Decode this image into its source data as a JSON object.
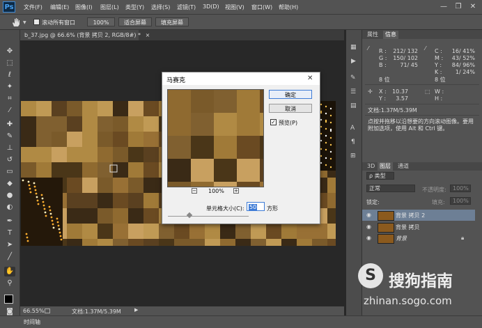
{
  "app": {
    "logo": "Ps"
  },
  "menu": [
    "文件(F)",
    "编辑(E)",
    "图像(I)",
    "图层(L)",
    "类型(Y)",
    "选择(S)",
    "滤镜(T)",
    "3D(D)",
    "视图(V)",
    "窗口(W)",
    "帮助(H)"
  ],
  "window_controls": {
    "minimize": "—",
    "restore": "❐",
    "close": "✕"
  },
  "options": {
    "scroll_all_label": "滚动所有窗口",
    "zoom_100": "100%",
    "fit_screen": "适合屏幕",
    "fill_screen": "填充屏幕"
  },
  "document": {
    "tab_label": "b_37.jpg @ 66.6% (背景 拷贝 2, RGB/8#) *",
    "tab_close": "×",
    "zoom": "66.55%",
    "doc_size": "文档:1.37M/5.39M"
  },
  "timeline_label": "时间轴",
  "dialog": {
    "title": "马赛克",
    "close": "✕",
    "ok": "确定",
    "cancel": "取消",
    "preview_label": "预览(P)",
    "preview_checked": true,
    "zoom_minus": "−",
    "zoom_plus": "+",
    "zoom_pct": "100%",
    "cell_size_label": "单元格大小(C):",
    "cell_size_value": "50",
    "cell_unit": "方形"
  },
  "info_panel": {
    "tabs": [
      "属性",
      "信息"
    ],
    "rgb_labels": [
      "R :",
      "G :",
      "B :"
    ],
    "rgb_values": [
      "212/ 132",
      "150/ 102",
      "71/ 45"
    ],
    "cmyk_labels": [
      "C :",
      "M :",
      "Y :",
      "K :"
    ],
    "cmyk_values": [
      "16/ 41%",
      "43/ 52%",
      "84/ 96%",
      "1/ 24%"
    ],
    "bit_left": "8 位",
    "bit_right": "8 位",
    "xy_labels": [
      "X :",
      "Y :"
    ],
    "xy_values": [
      "10.37",
      "3.57"
    ],
    "wh_labels": [
      "W :",
      "H :"
    ],
    "doc_size": "文档:1.37M/5.39M",
    "hint": "点按并拖移以沿想要的方向滚动图像。要用附加选项，使用 Alt 和 Ctrl 键。"
  },
  "layers_panel": {
    "tabs": [
      "3D",
      "图层",
      "通道"
    ],
    "filter_type": "ρ 类型",
    "blend_mode": "正常",
    "opacity_label": "不透明度:",
    "opacity_value": "100%",
    "lock_label": "锁定:",
    "fill_label": "填充:",
    "fill_value": "100%",
    "layers": [
      {
        "name": "背景 拷贝 2",
        "selected": true
      },
      {
        "name": "背景 拷贝",
        "selected": false
      },
      {
        "name": "背景",
        "selected": false,
        "locked": true
      }
    ]
  },
  "watermark": {
    "brand": "搜狗指南",
    "url": "zhinan.sogo.com"
  },
  "colors": {
    "chrome": "#535353",
    "workspace": "#282828",
    "selected_layer": "#6d7f95",
    "accent_blue": "#3d7bd6"
  }
}
